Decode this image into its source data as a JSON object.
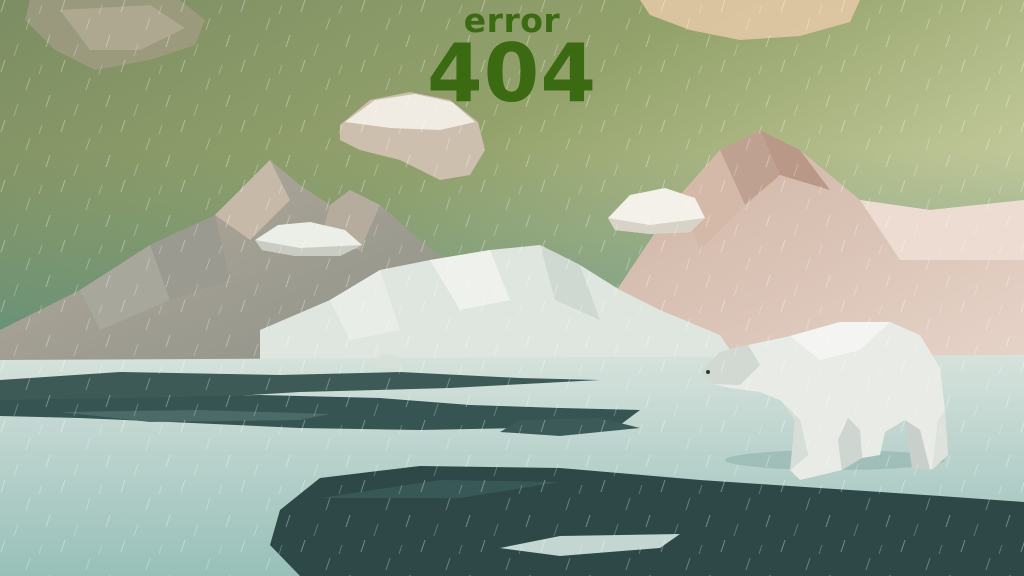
{
  "page": {
    "error_label": "error",
    "error_code": "404"
  },
  "scene": {
    "sky_top": "#b9c28a",
    "sky_bottom": "#6aa096",
    "ice": "#c9ddd8",
    "water": "#2f4d4c",
    "mountain_left": "#a7a89c",
    "mountain_right": "#d9c1b2",
    "heading_color": "#3b6a13"
  }
}
